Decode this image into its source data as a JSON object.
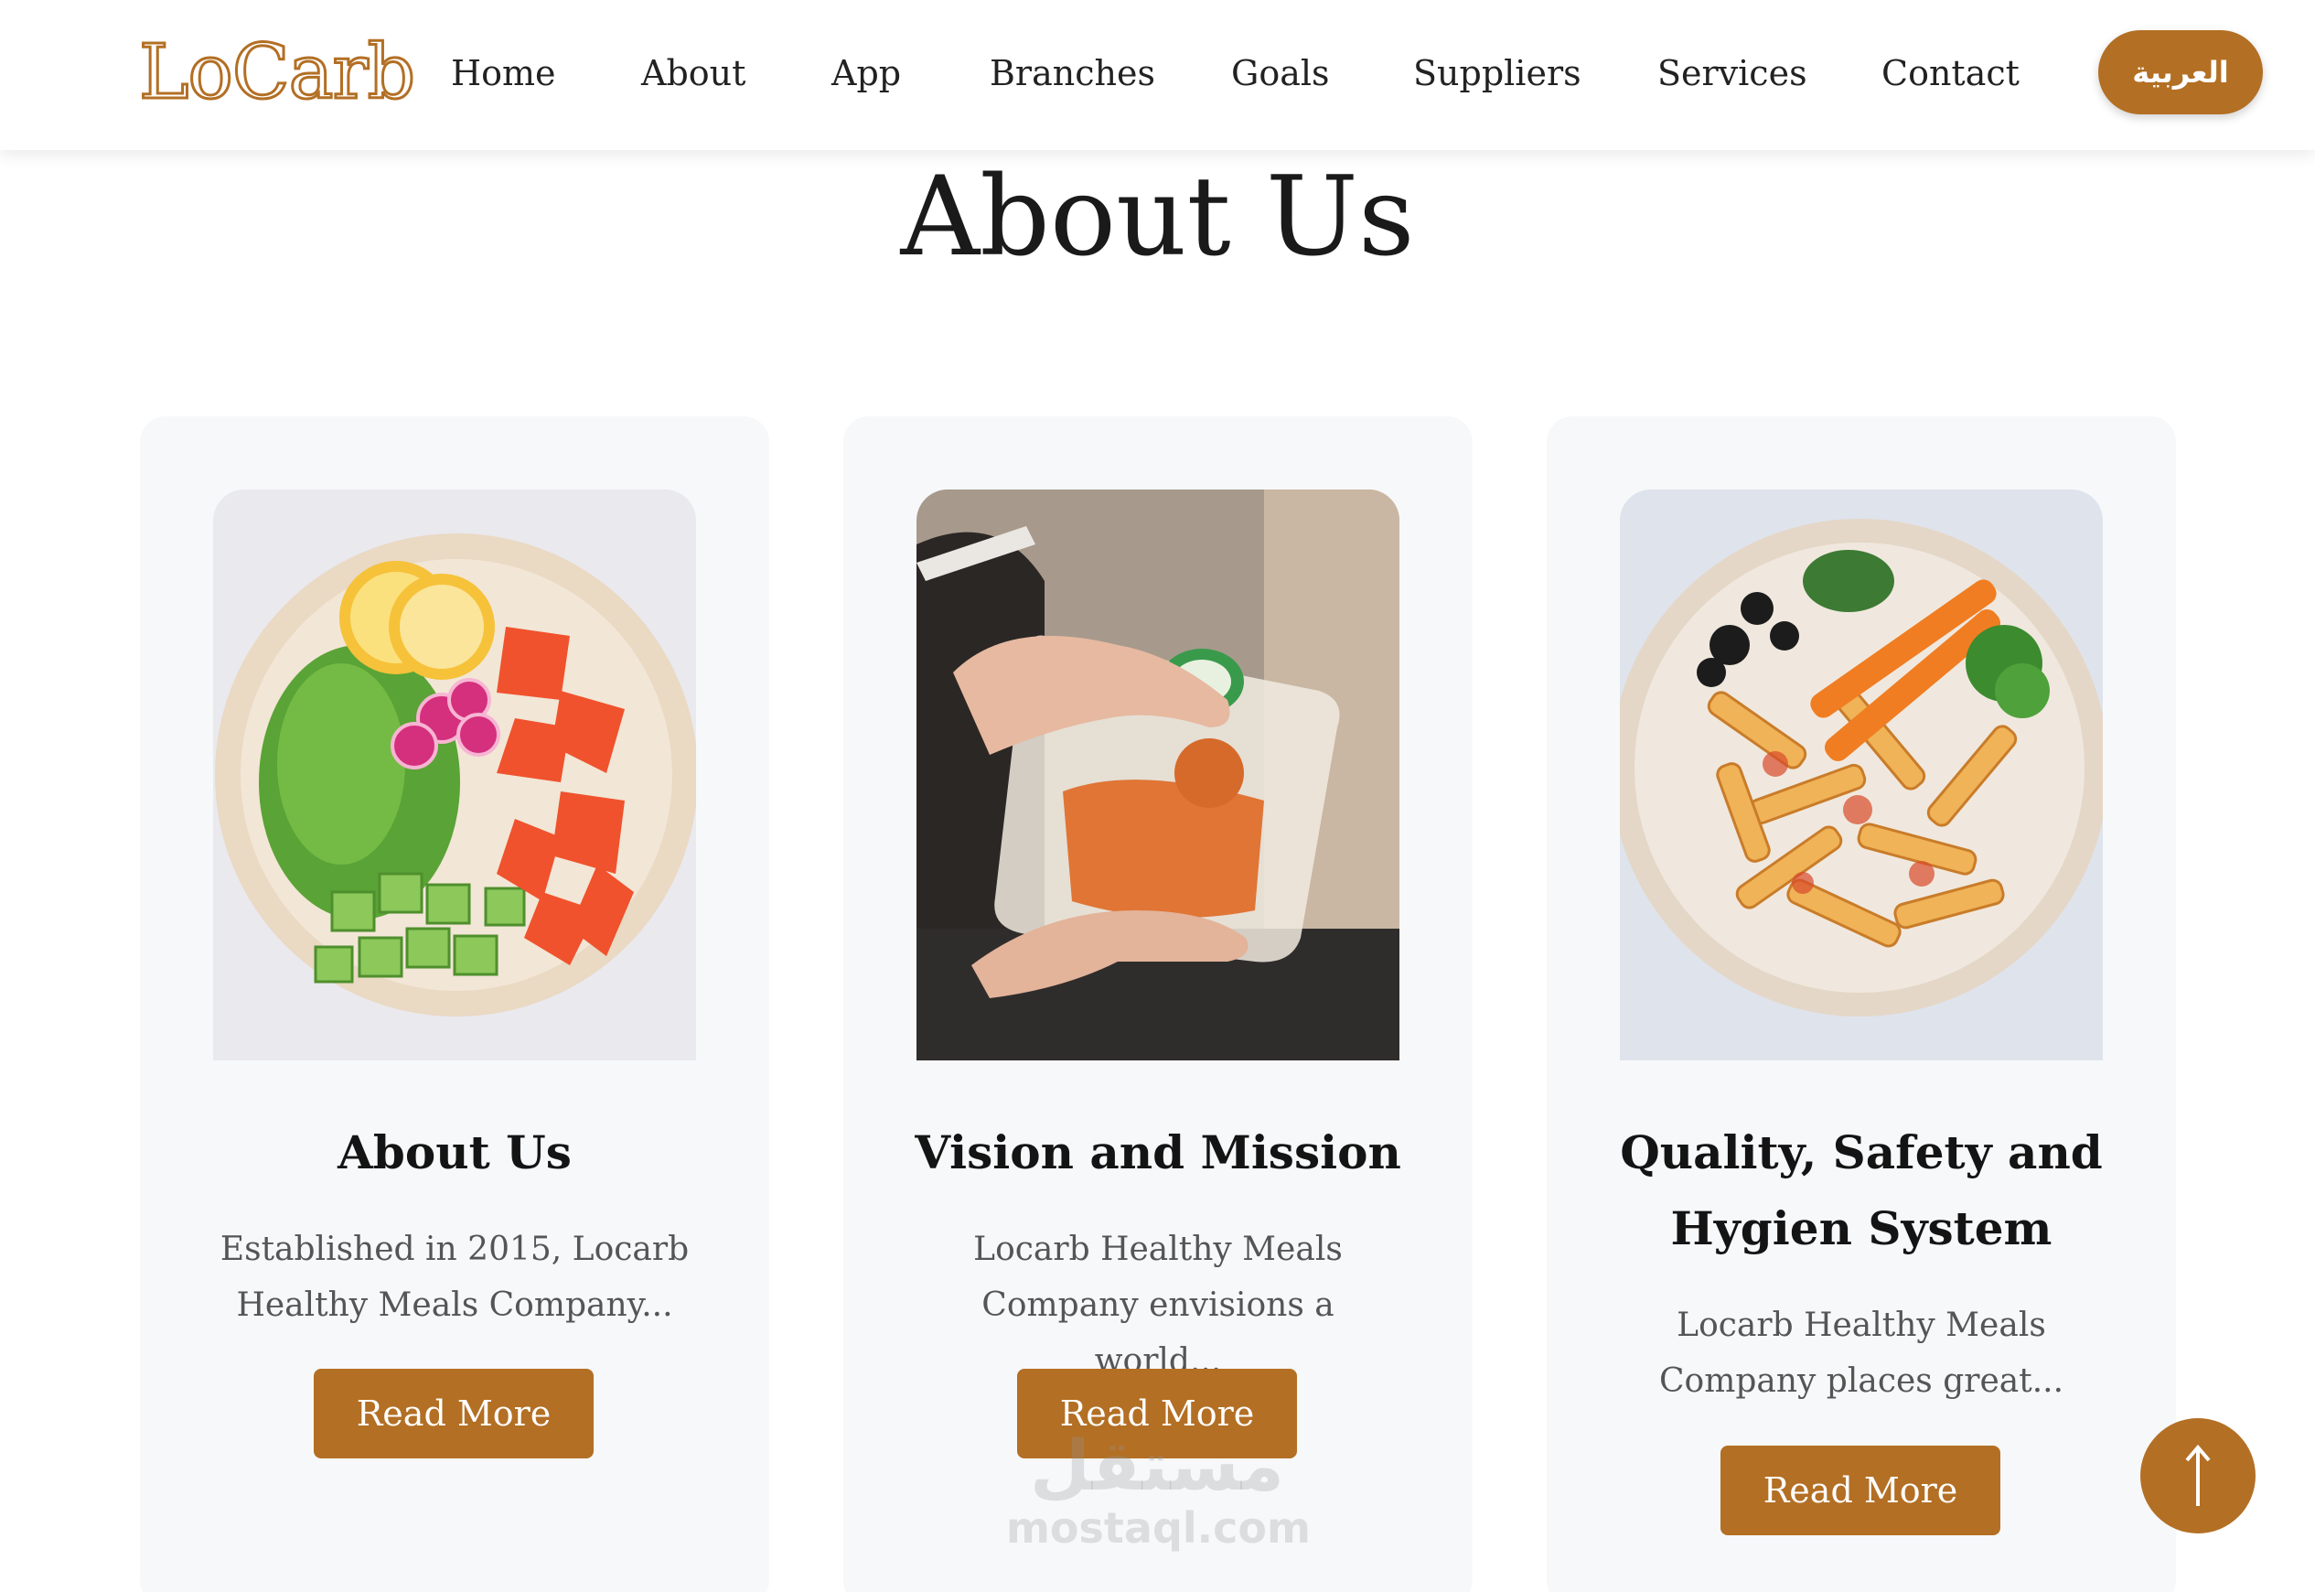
{
  "brand": {
    "logo": "LoCarb",
    "accent_color": "#b36f24"
  },
  "nav": {
    "items": [
      "Home",
      "About",
      "App",
      "Branches",
      "Goals",
      "Suppliers",
      "Services",
      "Contact"
    ],
    "lang_button": "العربية"
  },
  "page": {
    "title": "About Us"
  },
  "cards": [
    {
      "title": "About Us",
      "text": "Established in 2015, Locarb Healthy Meals Company...",
      "button": "Read More",
      "image": "salad-bowl-image"
    },
    {
      "title": "Vision and Mission",
      "text": "Locarb Healthy Meals Company envisions a world...",
      "button": "Read More",
      "image": "meal-container-image"
    },
    {
      "title": "Quality, Safety and Hygien System",
      "text": "Locarb Healthy Meals Company places great...",
      "button": "Read More",
      "image": "pasta-bowl-image"
    }
  ],
  "scroll_top": {
    "icon": "arrow-up-icon"
  },
  "watermark": {
    "arabic": "مستقل",
    "latin": "mostaql.com"
  }
}
